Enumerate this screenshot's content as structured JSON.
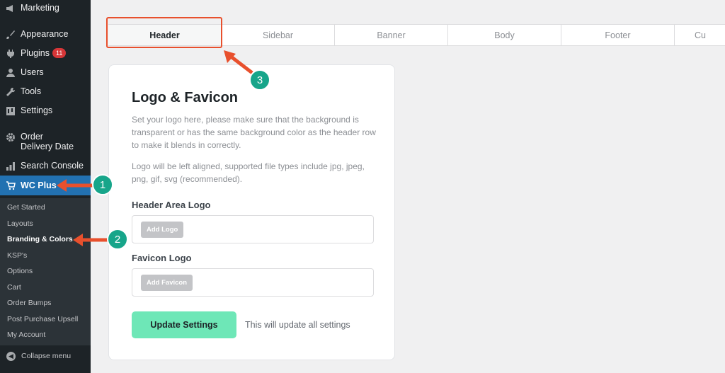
{
  "sidebar": {
    "menu": [
      {
        "label": "Marketing",
        "icon": "megaphone-icon"
      },
      {
        "label": "Appearance",
        "icon": "paintbrush-icon"
      },
      {
        "label": "Plugins",
        "icon": "plugin-icon",
        "badge": "11"
      },
      {
        "label": "Users",
        "icon": "user-icon"
      },
      {
        "label": "Tools",
        "icon": "wrench-icon"
      },
      {
        "label": "Settings",
        "icon": "settings-icon"
      },
      {
        "label": "Order Delivery Date",
        "icon": "gear-icon"
      },
      {
        "label": "Search Console",
        "icon": "bar-chart-icon"
      },
      {
        "label": "WC Plus",
        "icon": "cart-icon"
      }
    ],
    "submenu": [
      "Get Started",
      "Layouts",
      "Branding & Colors",
      "KSP's",
      "Options",
      "Cart",
      "Order Bumps",
      "Post Purchase Upsell",
      "My Account"
    ],
    "collapse_label": "Collapse menu"
  },
  "tabs": [
    "Header",
    "Sidebar",
    "Banner",
    "Body",
    "Footer",
    "Cu"
  ],
  "card": {
    "title": "Logo & Favicon",
    "desc1": "Set your logo here, please make sure that the background is transparent or has the same background color as the header row to make it blends in correctly.",
    "desc2": "Logo will be left aligned, supported file types include jpg, jpeg, png, gif, svg (recommended).",
    "header_logo_label": "Header Area Logo",
    "add_logo": "Add Logo",
    "favicon_label": "Favicon Logo",
    "add_favicon": "Add Favicon",
    "update_button": "Update Settings",
    "update_note": "This will update all settings"
  },
  "callouts": [
    "1",
    "2",
    "3"
  ],
  "colors": {
    "sidebar_bg": "#1d2327",
    "active_blue": "#2271b1",
    "accent_green": "#6ee7b7",
    "annotation_red": "#e8502d",
    "step_teal": "#17a58a"
  }
}
